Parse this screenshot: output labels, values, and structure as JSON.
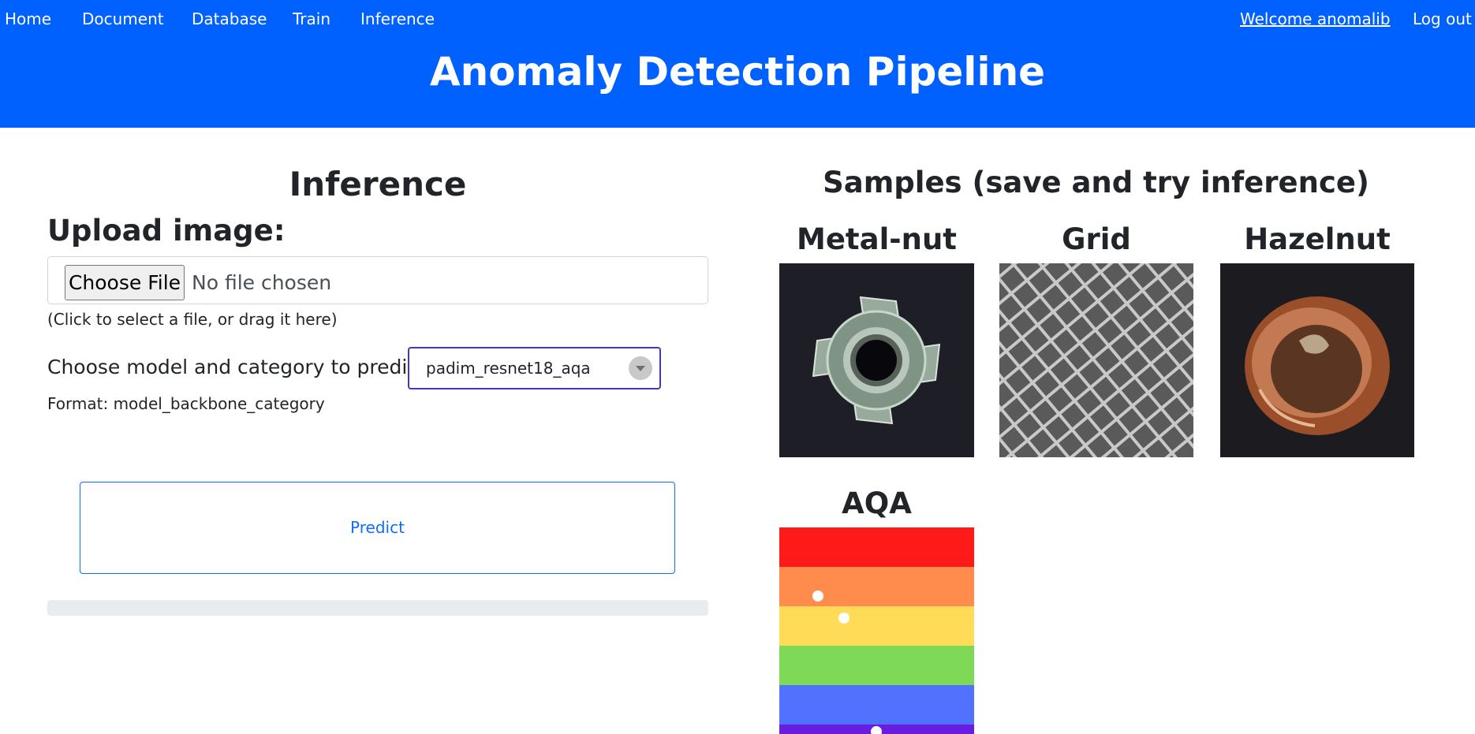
{
  "nav": {
    "home": "Home",
    "document": "Document",
    "database": "Database",
    "train": "Train",
    "inference": "Inference",
    "welcome": "Welcome anomalib",
    "logout": "Log out"
  },
  "site_title": "Anomaly Detection Pipeline",
  "inference": {
    "title": "Inference",
    "upload_label": "Upload image:",
    "choose_file_label": "Choose File",
    "no_file_text": "No file chosen",
    "hint": "(Click to select a file, or drag it here)",
    "model_label": "Choose model and category to predict:",
    "model_selected": "padim_resnet18_aqa",
    "format_note": "Format: model_backbone_category",
    "predict_label": "Predict",
    "progress": 0
  },
  "samples": {
    "title": "Samples (save and try inference)",
    "items": [
      {
        "label": "Metal-nut"
      },
      {
        "label": "Grid"
      },
      {
        "label": "Hazelnut"
      },
      {
        "label": "AQA"
      }
    ]
  },
  "colors": {
    "brand_blue": "#0061fe",
    "link_blue": "#0d6efd",
    "aqa_stripes": [
      "#ff1a1a",
      "#ff8c4d",
      "#ffdb58",
      "#7ed957",
      "#5271ff",
      "#6a1ce0"
    ]
  }
}
